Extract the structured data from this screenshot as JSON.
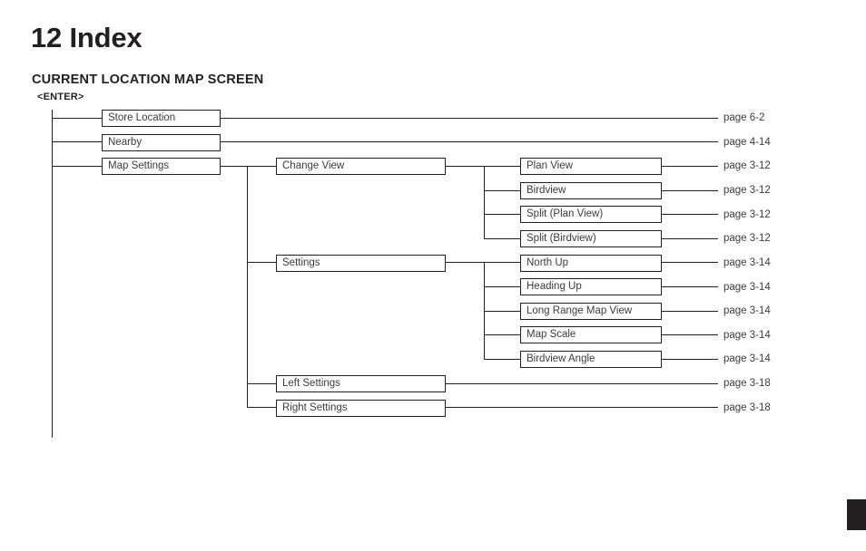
{
  "document": {
    "chapter_title": "12 Index",
    "section_title": "CURRENT LOCATION MAP SCREEN",
    "root_label": "<ENTER>",
    "ink_color": "#231f20",
    "text_color": "#3c3b3c"
  },
  "tree": {
    "level1": [
      {
        "label": "Store Location",
        "page": "page 6-2"
      },
      {
        "label": "Nearby",
        "page": "page 4-14"
      },
      {
        "label": "Map Settings",
        "page": ""
      }
    ],
    "level2": [
      {
        "label": "Change View",
        "page": ""
      },
      {
        "label": "Settings",
        "page": ""
      },
      {
        "label": "Left Settings",
        "page": "page 3-18"
      },
      {
        "label": "Right Settings",
        "page": "page 3-18"
      }
    ],
    "level3_change_view": [
      {
        "label": "Plan View",
        "page": "page 3-12"
      },
      {
        "label": "Birdview",
        "page": "page 3-12"
      },
      {
        "label": "Split (Plan View)",
        "page": "page 3-12"
      },
      {
        "label": "Split (Birdview)",
        "page": "page 3-12"
      }
    ],
    "level3_settings": [
      {
        "label": "North Up",
        "page": "page 3-14"
      },
      {
        "label": "Heading Up",
        "page": "page 3-14"
      },
      {
        "label": "Long Range Map View",
        "page": "page 3-14"
      },
      {
        "label": "Map Scale",
        "page": "page 3-14"
      },
      {
        "label": "Birdview Angle",
        "page": "page 3-14"
      }
    ]
  }
}
